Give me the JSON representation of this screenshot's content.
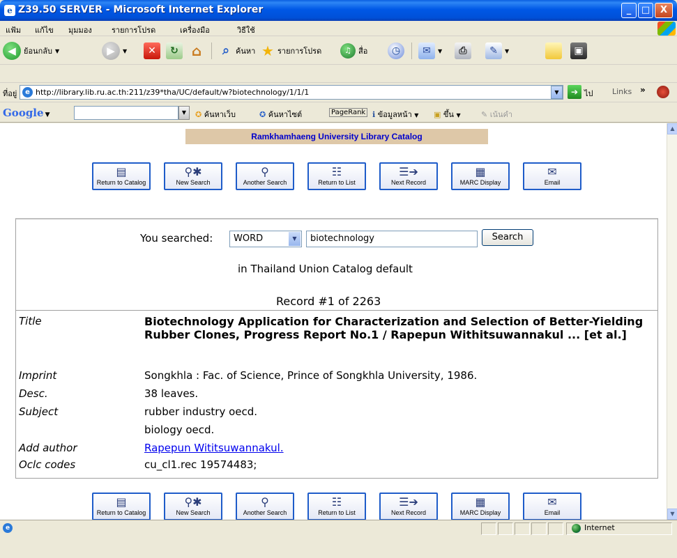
{
  "window": {
    "title": "Z39.50 SERVER - Microsoft Internet Explorer",
    "min": "_",
    "max": "□",
    "close": "X"
  },
  "menu": [
    "แฟ้ม",
    "แก้ไข",
    "มุมมอง",
    "รายการโปรด",
    "เครื่องมือ",
    "วิธีใช้"
  ],
  "toolbar": {
    "back": "ย้อนกลับ",
    "search": "ค้นหา",
    "favorites": "รายการโปรด",
    "media": "สื่อ"
  },
  "address": {
    "label": "ที่อยู่",
    "url": "http://library.lib.ru.ac.th:211/z39*tha/UC/default/w?biotechnology/1/1/1",
    "go": "ไป",
    "links": "Links"
  },
  "googlebar": {
    "logo": "Google",
    "search_web": "ค้นหาเว็บ",
    "search_site": "ค้นหาไซต์",
    "pagerank": "PageRank",
    "page_info": "ข้อมูลหน้า",
    "up": "ขึ้น",
    "highlight": "เน้นคำ"
  },
  "banner": "Ramkhamhaeng University Library Catalog",
  "nav_buttons": [
    {
      "label": "Return to Catalog",
      "icon": "return-to-catalog-icon"
    },
    {
      "label": "New Search",
      "icon": "new-search-icon"
    },
    {
      "label": "Another Search",
      "icon": "magnifier-icon"
    },
    {
      "label": "Return to List",
      "icon": "return-to-list-icon"
    },
    {
      "label": "Next Record",
      "icon": "next-record-icon"
    },
    {
      "label": "MARC Display",
      "icon": "marc-display-icon"
    },
    {
      "label": "Email",
      "icon": "email-icon"
    }
  ],
  "search": {
    "you_searched": "You searched:",
    "type": "WORD",
    "query": "biotechnology",
    "button": "Search",
    "scope": "in Thailand Union Catalog default",
    "record_count": "Record #1 of 2263"
  },
  "record": {
    "title_label": "Title",
    "title": "Biotechnology Application for Characterization and Selection of Better-Yielding Rubber Clones, Progress Report No.1 / Rapepun Withitsuwannakul ... [et al.]",
    "imprint_label": "Imprint",
    "imprint": "Songkhla : Fac. of Science, Prince of Songkhla University, 1986.",
    "desc_label": "Desc.",
    "desc": "38 leaves.",
    "subject_label": "Subject",
    "subject_1": "rubber industry oecd.",
    "subject_2": "biology oecd.",
    "author_label": "Add author",
    "author": "Rapepun Wititsuwannakul.",
    "oclc_label": "Oclc codes",
    "oclc": "cu_cl1.rec 19574483;"
  },
  "status": {
    "zone": "Internet"
  }
}
